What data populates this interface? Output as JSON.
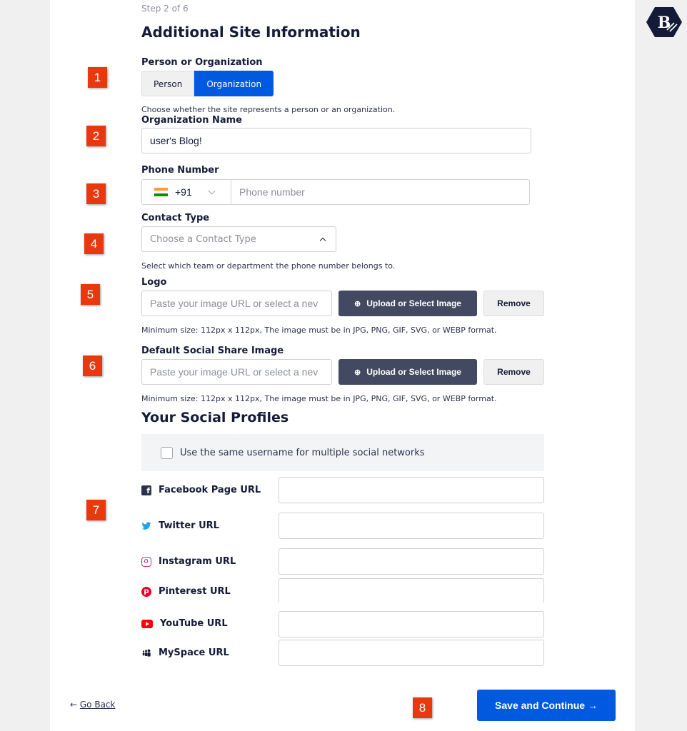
{
  "wizard": {
    "step": "Step 2 of 6",
    "title": "Additional Site Information"
  },
  "markers": [
    "1",
    "2",
    "3",
    "4",
    "5",
    "6",
    "7",
    "8"
  ],
  "person_org": {
    "label": "Person or Organization",
    "options": [
      "Person",
      "Organization"
    ],
    "selected": "Organization",
    "help": "Choose whether the site represents a person or an organization."
  },
  "org_name": {
    "label": "Organization Name",
    "value": "user's Blog!"
  },
  "phone": {
    "label": "Phone Number",
    "country_code": "+91",
    "placeholder": "Phone number"
  },
  "contact_type": {
    "label": "Contact Type",
    "placeholder": "Choose a Contact Type",
    "help": "Select which team or department the phone number belongs to."
  },
  "logo": {
    "label": "Logo",
    "placeholder": "Paste your image URL or select a nev",
    "upload_label": "Upload or Select Image",
    "remove_label": "Remove",
    "help": "Minimum size: 112px x 112px, The image must be in JPG, PNG, GIF, SVG, or WEBP format."
  },
  "share_image": {
    "label": "Default Social Share Image",
    "placeholder": "Paste your image URL or select a nev",
    "upload_label": "Upload or Select Image",
    "remove_label": "Remove",
    "help": "Minimum size: 112px x 112px, The image must be in JPG, PNG, GIF, SVG, or WEBP format."
  },
  "social": {
    "title": "Your Social Profiles",
    "same_username_label": "Use the same username for multiple social networks",
    "profiles": [
      {
        "label": "Facebook Page URL",
        "icon": "facebook-icon",
        "color": "#3b5998"
      },
      {
        "label": "Twitter URL",
        "icon": "twitter-icon",
        "color": "#1da1f2"
      },
      {
        "label": "Instagram URL",
        "icon": "instagram-icon",
        "color": "#c13584"
      },
      {
        "label": "Pinterest URL",
        "icon": "pinterest-icon",
        "color": "#e60023"
      },
      {
        "label": "YouTube URL",
        "icon": "youtube-icon",
        "color": "#ff0000"
      },
      {
        "label": "MySpace URL",
        "icon": "myspace-icon",
        "color": "#141b38"
      }
    ]
  },
  "footer": {
    "back_label": "Go Back",
    "save_label": "Save and Continue →"
  },
  "colors": {
    "accent": "#005ae0",
    "marker": "#e8380d",
    "dark_button": "#434960"
  }
}
